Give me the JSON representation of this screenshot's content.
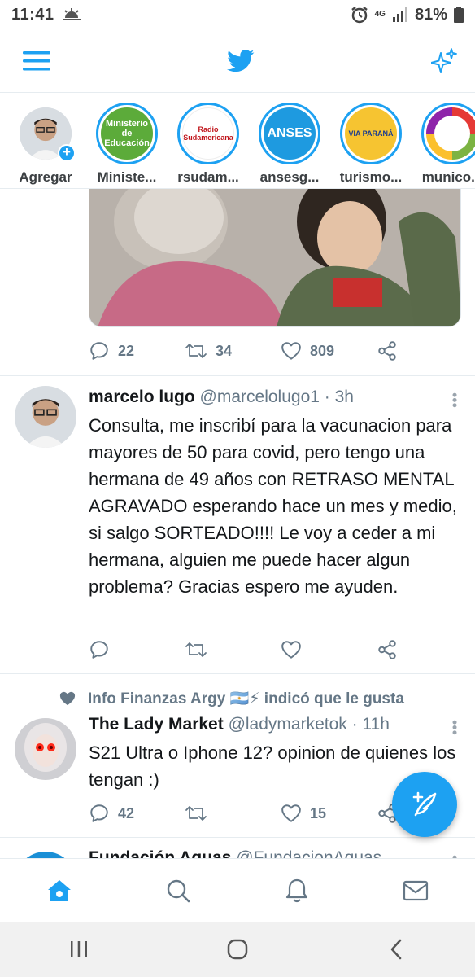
{
  "status_bar": {
    "time": "11:41",
    "network": "4G",
    "battery": "81%"
  },
  "fleets": [
    {
      "label": "Agregar",
      "kind": "self"
    },
    {
      "label": "Ministe...",
      "avatar_text": "Ministerio de Educación"
    },
    {
      "label": "rsudam...",
      "avatar_text": "Radio Sudamericana"
    },
    {
      "label": "ansesg...",
      "avatar_text": "ANSES"
    },
    {
      "label": "turismo...",
      "avatar_text": "VIA PARANÁ"
    },
    {
      "label": "munico..."
    }
  ],
  "tweet0": {
    "replies": "22",
    "retweets": "34",
    "likes": "809"
  },
  "tweet1": {
    "name": "marcelo lugo",
    "handle": "@marcelolugo1 · 3h",
    "text": "Consulta, me inscribí para la vacunacion para mayores de 50 para covid, pero tengo una hermana de 49 años con RETRASO MENTAL AGRAVADO esperando hace un mes y medio, si salgo SORTEADO!!!! Le voy a ceder a mi hermana, alguien me puede hacer algun problema? Gracias espero me ayuden."
  },
  "tweet2": {
    "social_context": "Info Finanzas Argy 🇦🇷⚡ indicó que le gusta",
    "name": "The Lady Market",
    "handle": "@ladymarketok · 11h",
    "text": "S21 Ultra o Iphone 12? opinion de quienes los tengan :)",
    "replies": "42",
    "likes": "15"
  },
  "tweet3": {
    "name": "Fundación Aguas",
    "handle": "@FundacionAguas"
  },
  "colors": {
    "accent": "#1da1f2",
    "text": "#14171a",
    "secondary": "#657786"
  }
}
